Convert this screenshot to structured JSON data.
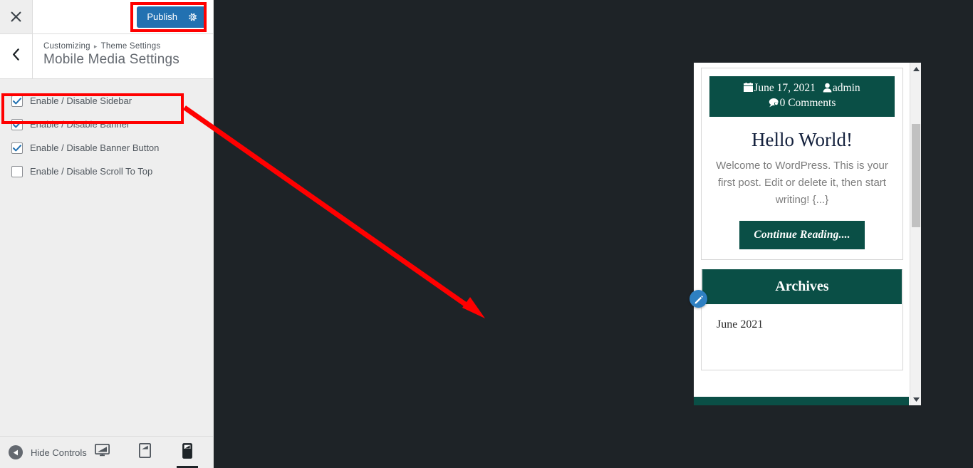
{
  "colors": {
    "accent_blue": "#2271b1",
    "annotation_red": "#ff0000",
    "theme_teal": "#0a4f46",
    "preview_bg": "#1e2327",
    "panel_bg": "#eee"
  },
  "header": {
    "close_icon": "close-x-icon",
    "publish_label": "Publish",
    "publish_gear_icon": "gear-icon"
  },
  "breadcrumb": {
    "back_icon": "chevron-left-icon",
    "root": "Customizing",
    "separator": "▸",
    "section": "Theme Settings",
    "title": "Mobile Media Settings"
  },
  "controls": [
    {
      "label": "Enable / Disable Sidebar",
      "checked": true
    },
    {
      "label": "Enable / Disable Banner",
      "checked": true
    },
    {
      "label": "Enable / Disable Banner Button",
      "checked": true
    },
    {
      "label": "Enable / Disable Scroll To Top",
      "checked": false
    }
  ],
  "footer": {
    "hide_controls_label": "Hide Controls",
    "collapse_icon": "collapse-left-icon",
    "devices": [
      {
        "name": "desktop",
        "icon": "desktop-icon",
        "active": false
      },
      {
        "name": "tablet",
        "icon": "tablet-icon",
        "active": false
      },
      {
        "name": "mobile",
        "icon": "mobile-icon",
        "active": true
      }
    ]
  },
  "preview": {
    "post": {
      "date_icon": "calendar-icon",
      "date": "June 17, 2021",
      "author_icon": "user-icon",
      "author": "admin",
      "comments_icon": "comment-icon",
      "comments": "0 Comments",
      "title": "Hello World!",
      "excerpt": "Welcome to WordPress. This is your first post. Edit or delete it, then start writing! {...}",
      "read_more": "Continue Reading...."
    },
    "widget": {
      "title": "Archives",
      "items": [
        "June 2021"
      ]
    },
    "edit_shortcut_icon": "pencil-edit-icon",
    "scrollbar": {
      "up_icon": "scroll-up-arrow-icon",
      "down_icon": "scroll-down-arrow-icon"
    }
  },
  "annotations": {
    "highlight_publish": "red-rectangle-publish",
    "highlight_sidebar_control": "red-rectangle-sidebar-control",
    "arrow": "red-arrow-sidebar-to-archives"
  }
}
